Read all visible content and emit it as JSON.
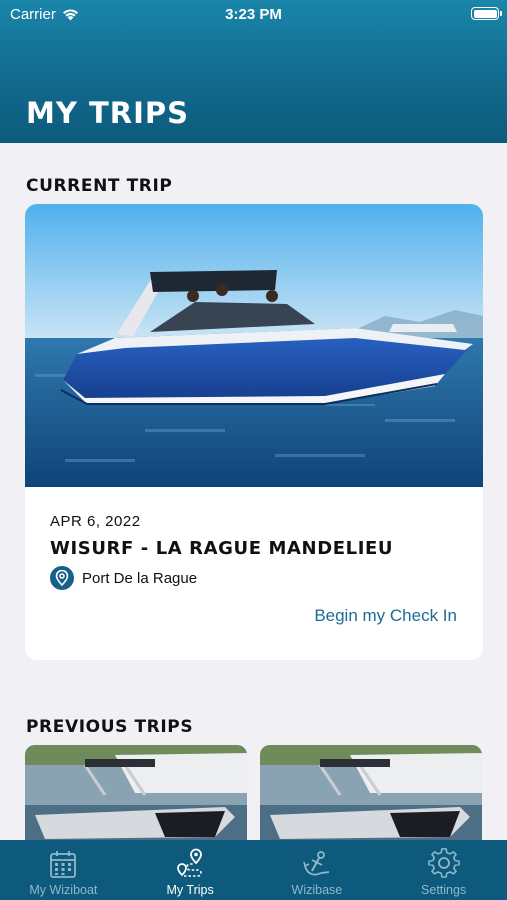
{
  "status_bar": {
    "carrier": "Carrier",
    "time": "3:23 PM"
  },
  "header": {
    "title": "MY TRIPS"
  },
  "current_trip": {
    "section_title": "CURRENT TRIP",
    "date": "APR 6, 2022",
    "name": "WISURF - LA RAGUE MANDELIEU",
    "location": "Port De la Rague",
    "checkin_label": "Begin my Check In",
    "location_icon": "map-pin-icon"
  },
  "previous_trips": {
    "section_title": "PREVIOUS TRIPS"
  },
  "tabbar": {
    "tabs": [
      {
        "label": "My Wiziboat",
        "icon": "calendar-icon",
        "active": false
      },
      {
        "label": "My Trips",
        "icon": "route-map-icon",
        "active": true
      },
      {
        "label": "Wizibase",
        "icon": "anchor-icon",
        "active": false
      },
      {
        "label": "Settings",
        "icon": "gear-icon",
        "active": false
      }
    ]
  },
  "colors": {
    "accent": "#1d6c95",
    "header": "#136f93",
    "tabbar": "#0d5a7c",
    "background": "#f1f1f5"
  }
}
